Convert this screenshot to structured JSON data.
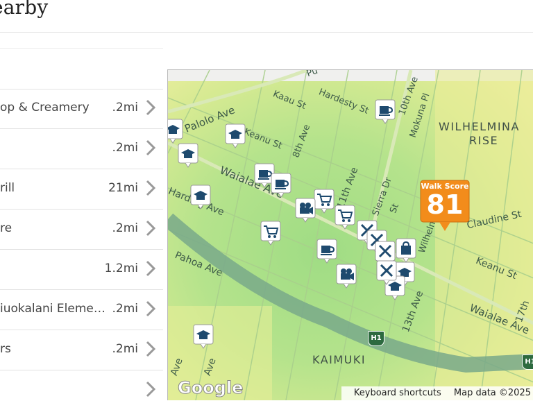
{
  "header": {
    "title": "earby"
  },
  "places": [
    {
      "name": "op & Creamery",
      "distance": ".2mi"
    },
    {
      "name": "",
      "distance": ".2mi"
    },
    {
      "name": "rill",
      "distance": "21mi"
    },
    {
      "name": "re",
      "distance": ".2mi"
    },
    {
      "name": "",
      "distance": "1.2mi"
    },
    {
      "name": "iuokalani Eleme…",
      "distance": ".2mi"
    },
    {
      "name": "rs",
      "distance": ".2mi"
    },
    {
      "name": "",
      "distance": ""
    }
  ],
  "map": {
    "walk_score_label": "Walk Score",
    "walk_score_value": "81",
    "street_labels": [
      "Palolo Ave",
      "Kaau St",
      "Hardesty St",
      "10th Ave",
      "Mokuna Pl",
      "Keanu St",
      "8th Ave",
      "Waialae Ave",
      "11th Ave",
      "Sierra Dr",
      "St",
      "Wilhelmina",
      "Claudine St",
      "Harding Ave",
      "Pahoa Ave",
      "Keanu St",
      "13th Ave",
      "Waialae Ave",
      "17th",
      "Ave",
      "Ave",
      "Pu"
    ],
    "area_labels": [
      "WILHELMINA",
      "RISE",
      "KAIMUKI"
    ],
    "highway_shield": "H1",
    "google_logo": "Google",
    "keyboard_shortcuts": "Keyboard shortcuts",
    "map_data": "Map data ©2025"
  },
  "colors": {
    "walk_score_badge": "#f28c1b",
    "marker_icon": "#1e4a6e",
    "heat_green": "#bfe48f",
    "heat_yellow": "#e8ee9a",
    "freeway": "#6aa07a"
  }
}
